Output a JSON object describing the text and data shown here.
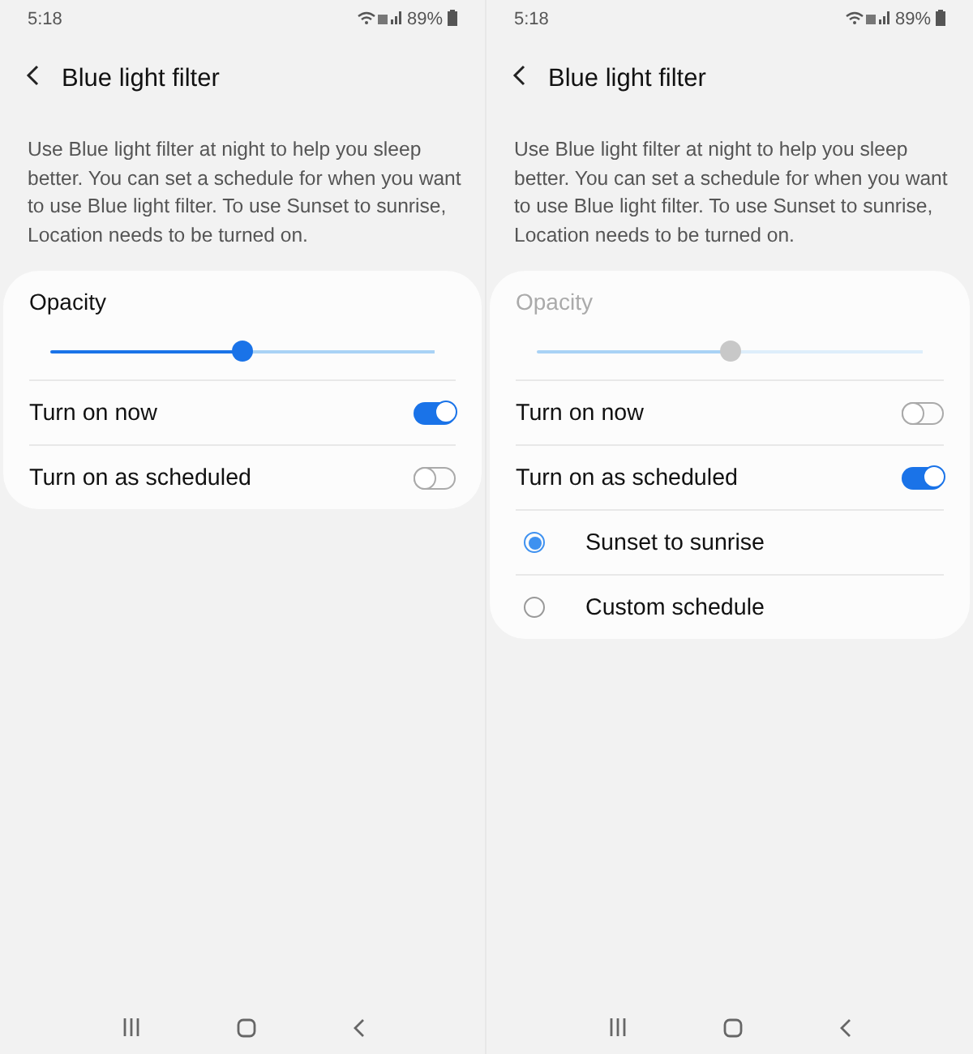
{
  "screens": [
    {
      "status_bar": {
        "time": "5:18",
        "battery": "89%"
      },
      "title": "Blue light filter",
      "description": "Use Blue light filter at night to help you sleep better. You can set a schedule for when you want to use Blue light filter. To use Sunset to sunrise, Location needs to be turned on.",
      "opacity": {
        "label": "Opacity",
        "disabled": false,
        "level": 0.5
      },
      "toggles": [
        {
          "label": "Turn on now",
          "on": true
        },
        {
          "label": "Turn on as scheduled",
          "on": false
        }
      ]
    },
    {
      "status_bar": {
        "time": "5:18",
        "battery": "89%"
      },
      "title": "Blue light filter",
      "description": "Use Blue light filter at night to help you sleep better. You can set a schedule for when you want to use Blue light filter. To use Sunset to sunrise, Location needs to be turned on.",
      "opacity": {
        "label": "Opacity",
        "disabled": true,
        "level": 0.5
      },
      "toggles": [
        {
          "label": "Turn on now",
          "on": false
        },
        {
          "label": "Turn on as scheduled",
          "on": true
        }
      ],
      "options": [
        {
          "label": "Sunset to sunrise",
          "selected": true
        },
        {
          "label": "Custom schedule",
          "selected": false
        }
      ]
    }
  ]
}
